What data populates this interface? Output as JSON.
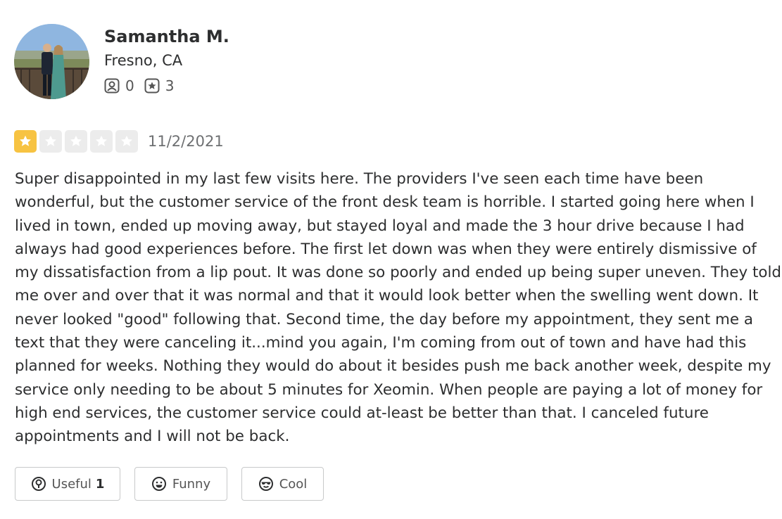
{
  "reviewer": {
    "name": "Samantha M.",
    "location": "Fresno, CA",
    "friends_count": "0",
    "reviews_count": "3",
    "avatar_icon": "avatar-photo"
  },
  "review": {
    "rating": 1,
    "max_rating": 5,
    "date": "11/2/2021",
    "text": "Super disappointed in my last few visits here. The providers I've seen each time have been wonderful, but the customer service of the front desk team is horrible. I started going here when I lived in town, ended up moving away, but stayed loyal and made the 3 hour drive because I had always had good experiences before. The first let down was when they were entirely dismissive of my dissatisfaction from a lip pout. It was done so poorly and ended up being super uneven. They told me over and over that it was normal and that it would look better when the swelling went down. It never looked \"good\" following that. Second time, the day before my appointment, they sent me a text that they were canceling it...mind you again, I'm coming from out of town and have had this planned for weeks. Nothing they would do about it besides push me back another week, despite my service only needing to be about 5 minutes for Xeomin. When people are paying a lot of money for high end services, the customer service could at-least be better than that. I canceled future appointments and I will not be back."
  },
  "actions": {
    "useful_label": "Useful",
    "useful_count": "1",
    "funny_label": "Funny",
    "cool_label": "Cool"
  },
  "colors": {
    "star_filled": "#f7c342",
    "star_empty": "#ececec",
    "text": "#2d2e2f"
  }
}
